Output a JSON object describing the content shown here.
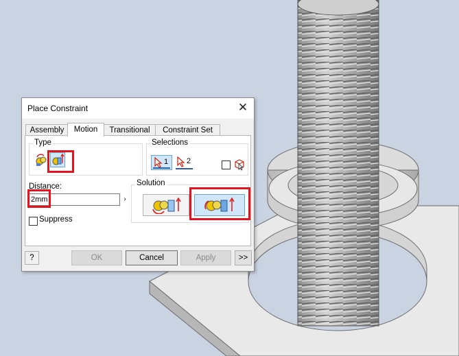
{
  "dialog": {
    "title": "Place Constraint",
    "tabs": [
      "Assembly",
      "Motion",
      "Transitional",
      "Constraint Set"
    ],
    "active_tab": "Motion",
    "type_label": "Type",
    "selections_label": "Selections",
    "selection_1": "1",
    "selection_2": "2",
    "distance_label": "Distance:",
    "distance_value": "2mm",
    "distance_arrow": "›",
    "solution_label": "Solution",
    "suppress_label": "Suppress",
    "buttons": {
      "ok": "OK",
      "cancel": "Cancel",
      "apply": "Apply",
      "more": ">>"
    },
    "help_icon": "?"
  },
  "colors": {
    "highlight_red": "#e3141f",
    "selected_blue": "#cfe7f8"
  }
}
